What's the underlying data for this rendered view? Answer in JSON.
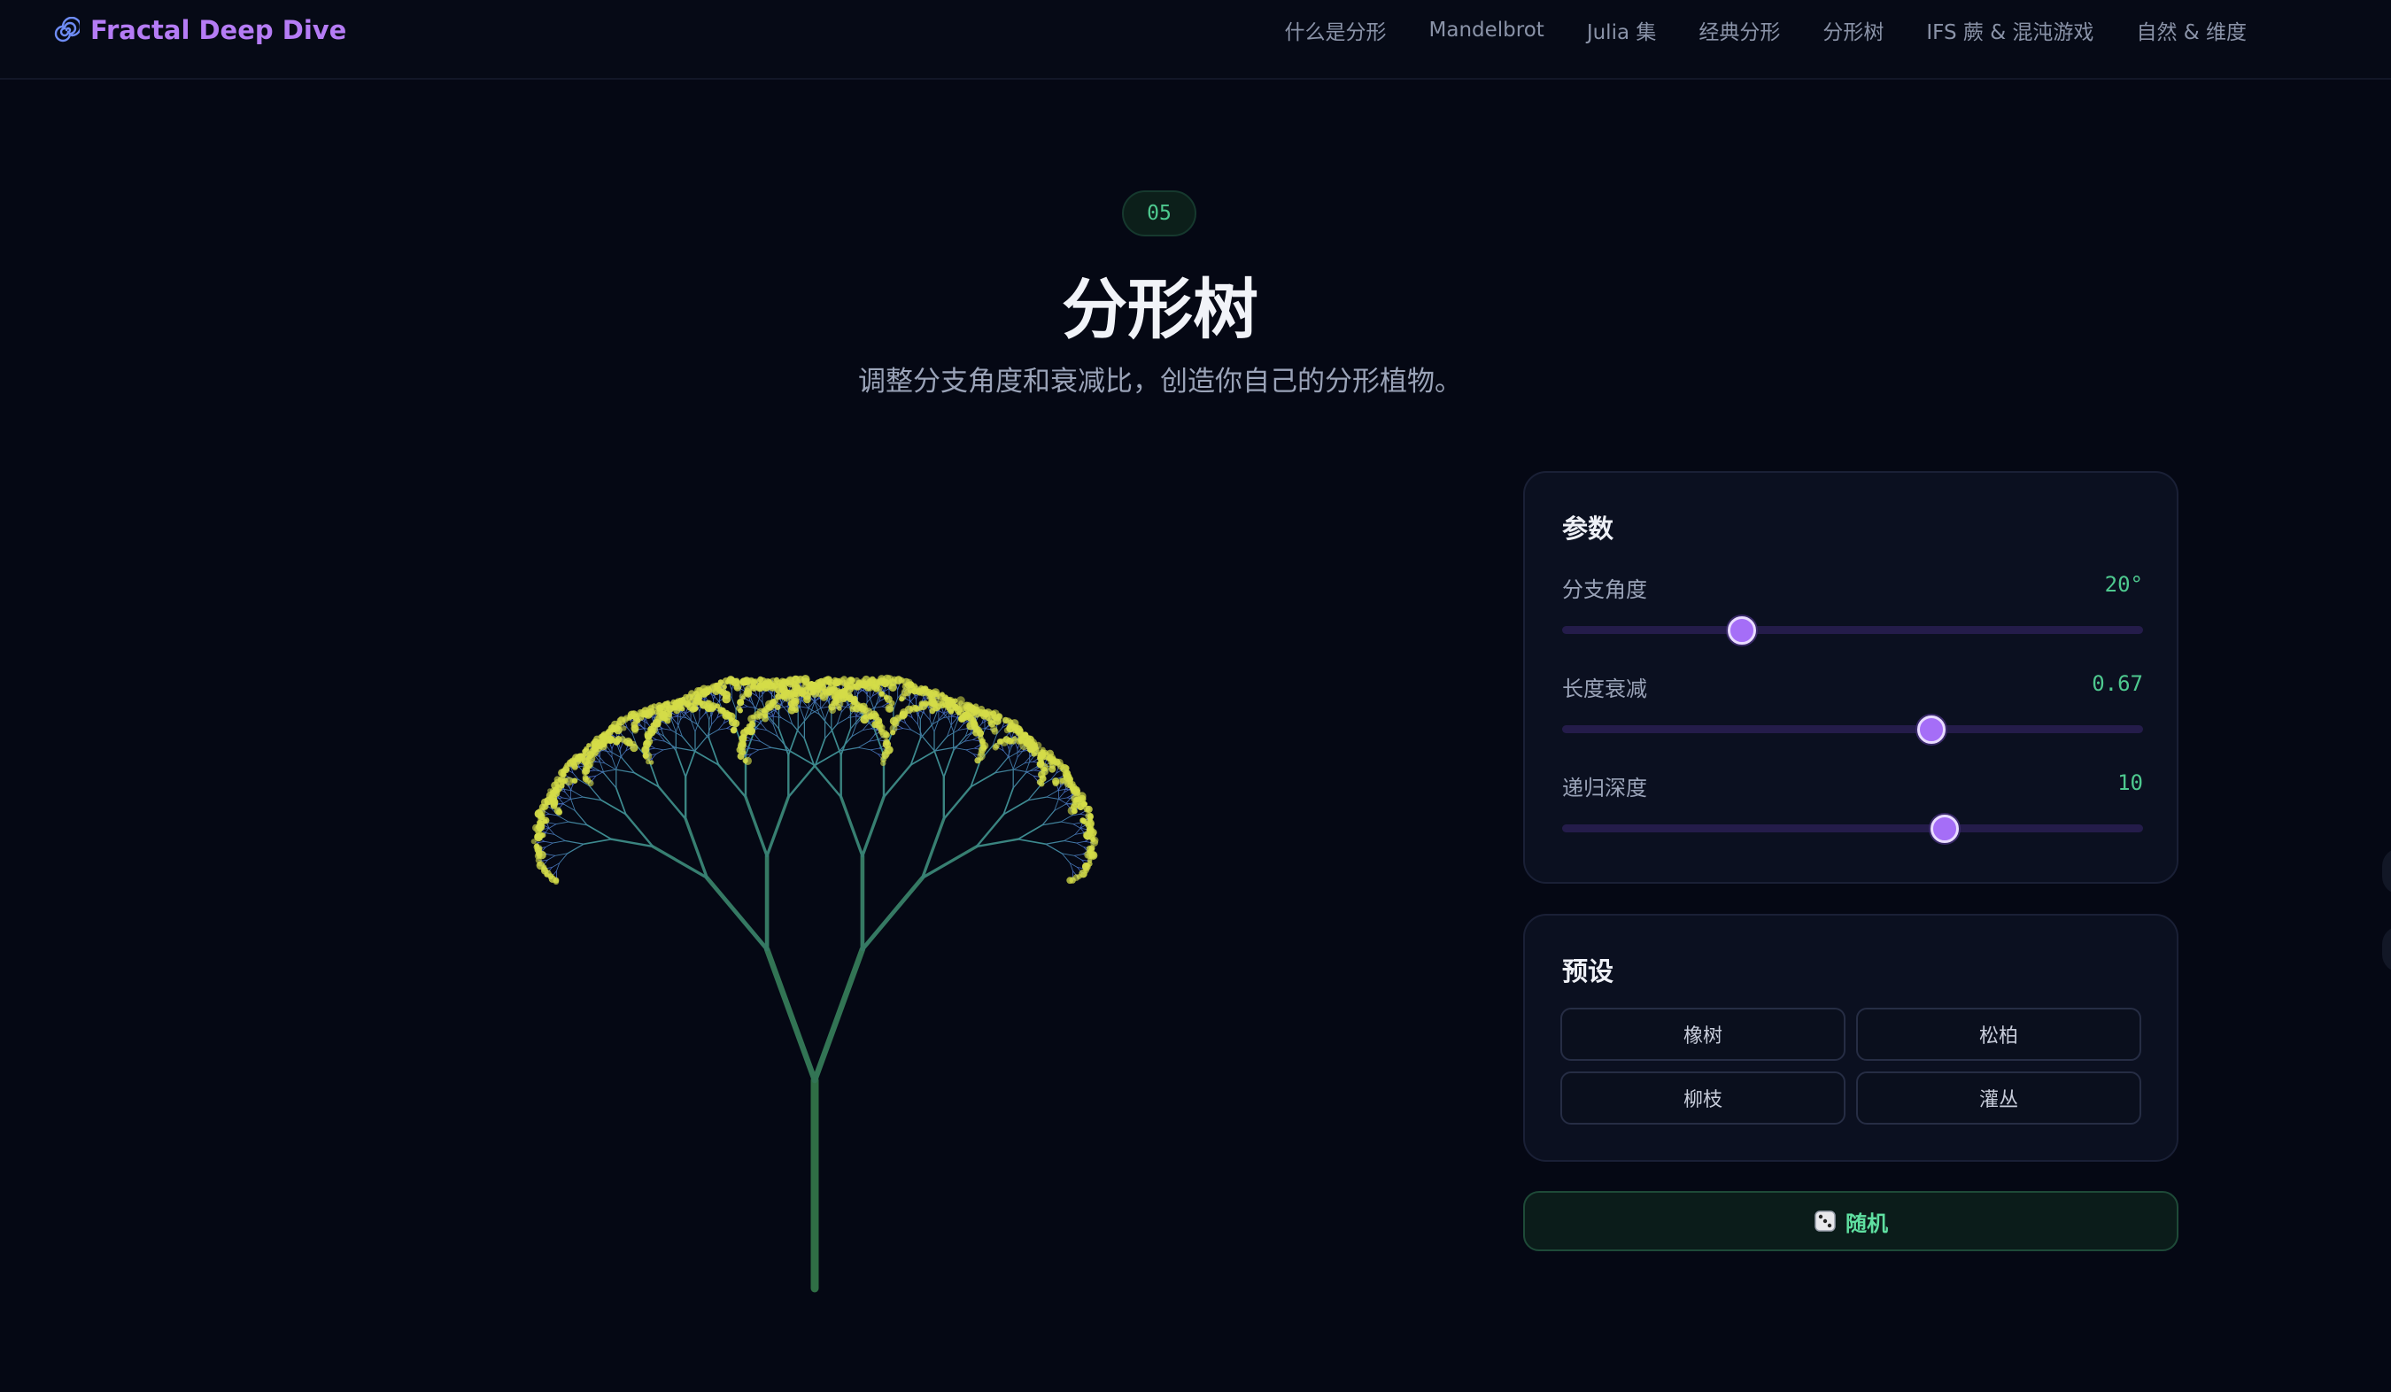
{
  "brand": {
    "name": "Fractal Deep Dive",
    "icon": "spiral-icon",
    "color": "#b57cf5"
  },
  "nav": {
    "items": [
      {
        "label": "什么是分形"
      },
      {
        "label": "Mandelbrot"
      },
      {
        "label": "Julia 集"
      },
      {
        "label": "经典分形"
      },
      {
        "label": "分形树"
      },
      {
        "label": "IFS 蕨 & 混沌游戏"
      },
      {
        "label": "自然 & 维度"
      }
    ]
  },
  "section": {
    "number": "05",
    "title": "分形树",
    "subtitle": "调整分支角度和衰减比，创造你自己的分形植物。"
  },
  "params": {
    "title": "参数",
    "angle": {
      "label": "分支角度",
      "value": "20°",
      "level": 0.31
    },
    "decay": {
      "label": "长度衰减",
      "value": "0.67",
      "level": 0.635
    },
    "depth": {
      "label": "递归深度",
      "value": "10",
      "level": 0.658
    }
  },
  "presets": {
    "title": "预设",
    "items": [
      {
        "label": "橡树"
      },
      {
        "label": "松柏"
      },
      {
        "label": "柳枝"
      },
      {
        "label": "灌丛"
      }
    ]
  },
  "random_button": {
    "icon": "dice-icon",
    "label": "随机"
  },
  "colors": {
    "background": "#050814",
    "accent_purple": "#a56ef7",
    "accent_green": "#4ec98f",
    "trunk": "#2f6e45",
    "branch": "#3d8a8f",
    "twig": "#4a62c8",
    "leaf": "#d4dc48"
  }
}
